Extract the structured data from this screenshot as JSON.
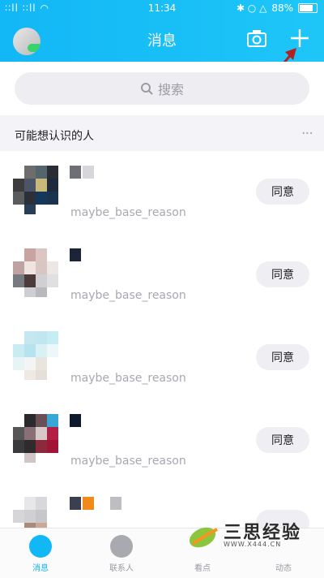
{
  "status_bar": {
    "signal": "∶∶ll ∶∶ll ◠",
    "time": "11:34",
    "icons": "✱ ○ △",
    "battery": "88%"
  },
  "header": {
    "title": "消息",
    "camera_icon": "camera-icon",
    "plus_icon": "plus-icon"
  },
  "search": {
    "placeholder": "搜索"
  },
  "section": {
    "title": "可能想认识的人",
    "more": "···"
  },
  "people": [
    {
      "reason": "maybe_base_reason",
      "action": "同意"
    },
    {
      "reason": "maybe_base_reason",
      "action": "同意"
    },
    {
      "reason": "maybe_base_reason",
      "action": "同意"
    },
    {
      "reason": "maybe_base_reason",
      "action": "同意"
    },
    {
      "reason": "",
      "action": ""
    }
  ],
  "tabs": [
    {
      "label": "消息",
      "active": true
    },
    {
      "label": "联系人",
      "active": false
    },
    {
      "label": "看点",
      "active": false
    },
    {
      "label": "动态",
      "active": false
    }
  ],
  "watermark": {
    "text": "三思经验",
    "sub": "WWW.X444.CN"
  },
  "colors": {
    "brand": "#12b7f5",
    "annotation_arrow": "#b22222"
  }
}
